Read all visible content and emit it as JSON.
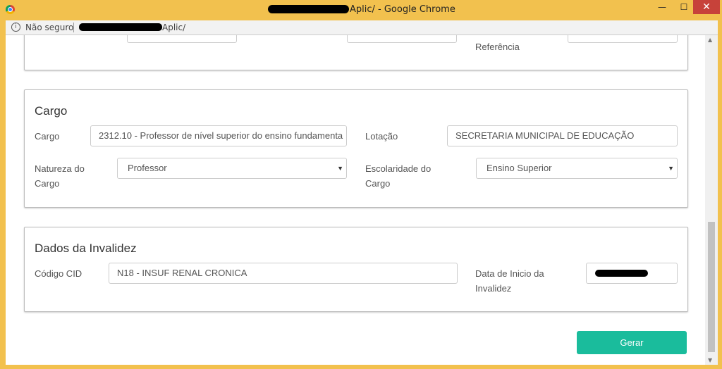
{
  "window": {
    "title": "Aplic/ - Google Chrome",
    "minimize": "—",
    "maximize": "☐",
    "close": "✕"
  },
  "address": {
    "info_icon": "i",
    "security": "Não seguro",
    "url": "Aplic/"
  },
  "top_panel": {
    "ref_label": "Referência"
  },
  "cargo_panel": {
    "title": "Cargo",
    "cargo_label": "Cargo",
    "cargo_value": "2312.10 - Professor de nível superior do ensino fundamenta",
    "lotacao_label": "Lotação",
    "lotacao_value": "SECRETARIA MUNICIPAL DE EDUCAÇÃO",
    "natureza_label_1": "Natureza do",
    "natureza_label_2": "Cargo",
    "natureza_value": "Professor",
    "escolaridade_label_1": "Escolaridade do",
    "escolaridade_label_2": "Cargo",
    "escolaridade_value": "Ensino Superior"
  },
  "invalidez_panel": {
    "title": "Dados da Invalidez",
    "cid_label": "Código CID",
    "cid_value": "N18 - INSUF RENAL CRONICA",
    "data_label_1": "Data de Inicio da",
    "data_label_2": "Invalidez"
  },
  "actions": {
    "gerar": "Gerar"
  },
  "colors": {
    "accent": "#1abc9c",
    "window_frame": "#f2c14e",
    "close_button": "#c7423a"
  }
}
